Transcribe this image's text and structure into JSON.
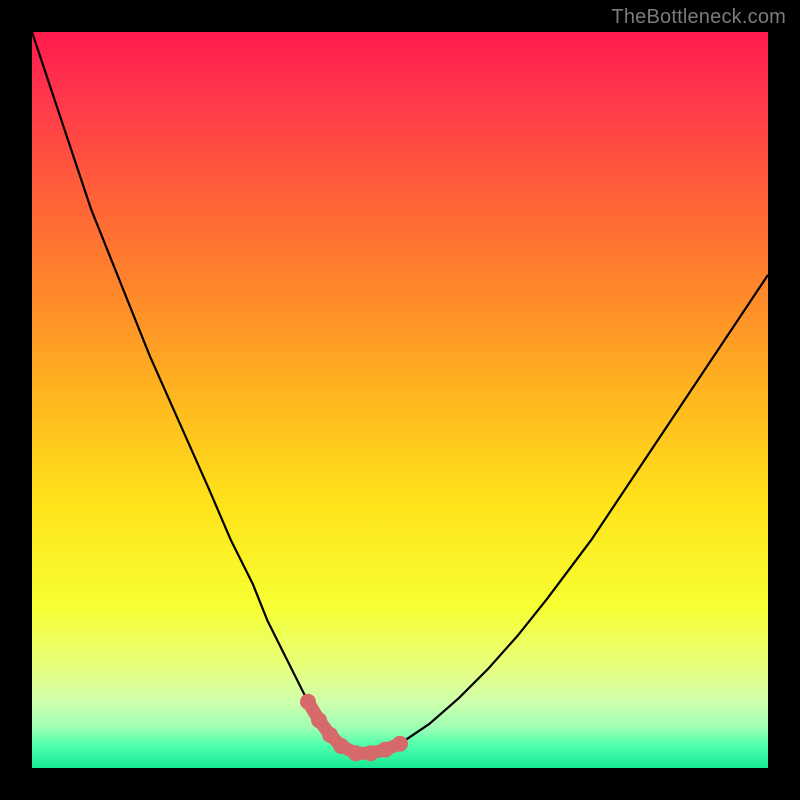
{
  "watermark": "TheBottleneck.com",
  "colors": {
    "frame": "#000000",
    "curve_stroke": "#000000",
    "marker_fill": "#d66a6a",
    "marker_stroke": "#d66a6a",
    "gradient_stops": [
      {
        "offset": 0.0,
        "color": "#ff1a4d"
      },
      {
        "offset": 0.1,
        "color": "#ff3a4a"
      },
      {
        "offset": 0.22,
        "color": "#ff6038"
      },
      {
        "offset": 0.36,
        "color": "#ff8a2a"
      },
      {
        "offset": 0.5,
        "color": "#ffb81f"
      },
      {
        "offset": 0.64,
        "color": "#ffe31a"
      },
      {
        "offset": 0.78,
        "color": "#f7ff33"
      },
      {
        "offset": 0.86,
        "color": "#e8ff7a"
      },
      {
        "offset": 0.91,
        "color": "#cfffad"
      },
      {
        "offset": 0.945,
        "color": "#9effb4"
      },
      {
        "offset": 0.97,
        "color": "#4dffad"
      },
      {
        "offset": 1.0,
        "color": "#17e893"
      }
    ]
  },
  "chart_data": {
    "type": "line",
    "title": "",
    "xlabel": "",
    "ylabel": "",
    "xlim": [
      0,
      100
    ],
    "ylim": [
      0,
      100
    ],
    "grid": false,
    "legend": false,
    "series": [
      {
        "name": "bottleneck-curve",
        "x": [
          0,
          2,
          5,
          8,
          12,
          16,
          20,
          24,
          27,
          30,
          32,
          34,
          36,
          37.5,
          39,
          40.5,
          42,
          44,
          46,
          48,
          50,
          54,
          58,
          62,
          66,
          70,
          76,
          82,
          88,
          94,
          100
        ],
        "y": [
          100,
          94,
          85,
          76,
          66,
          56,
          47,
          38,
          31,
          25,
          20,
          16,
          12,
          9,
          6.5,
          4.5,
          3,
          2,
          2,
          2.5,
          3.3,
          6,
          9.5,
          13.5,
          18,
          23,
          31,
          40,
          49,
          58,
          67
        ]
      },
      {
        "name": "optimal-markers",
        "x": [
          37.5,
          39,
          40.5,
          42,
          44,
          46,
          48,
          50
        ],
        "y": [
          9,
          6.5,
          4.5,
          3,
          2,
          2,
          2.5,
          3.3
        ]
      }
    ]
  }
}
